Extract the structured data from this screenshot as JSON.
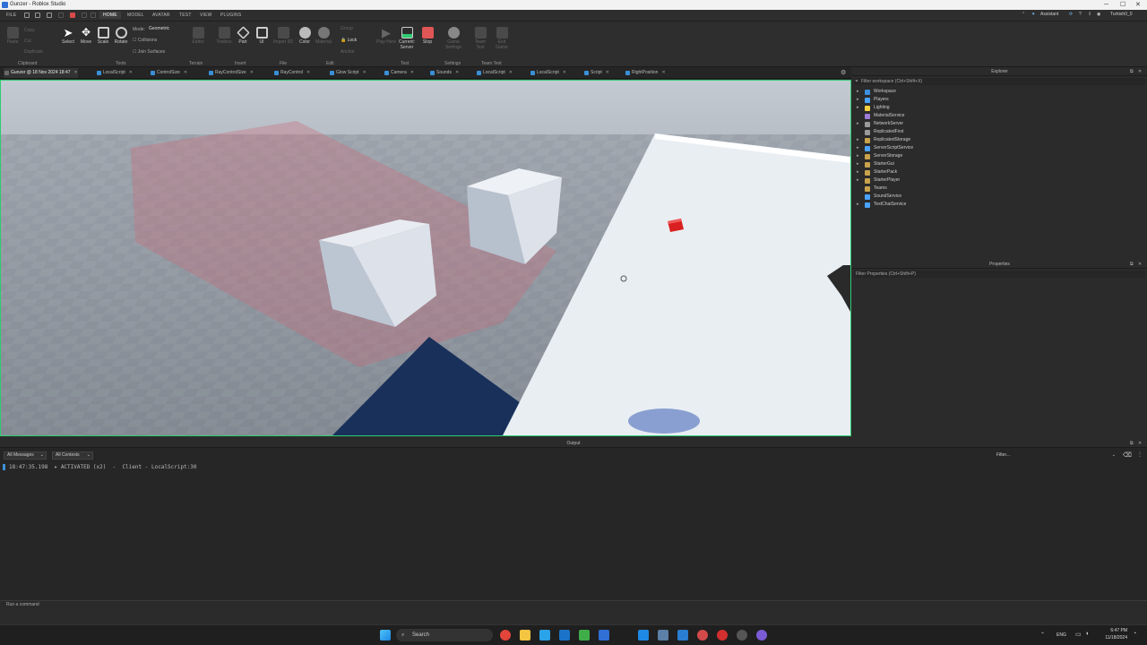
{
  "window": {
    "title": "Gunzer - Roblox Studio"
  },
  "menubar": {
    "tabs": [
      "FILE",
      "HOME",
      "MODEL",
      "AVATAR",
      "TEST",
      "VIEW",
      "PLUGINS"
    ],
    "active_tab": "HOME",
    "assistant_label": "Assistant",
    "user_label": "Turkish0_0"
  },
  "ribbon": {
    "clipboard": {
      "paste": "Paste",
      "copy": "Copy",
      "cut": "Cut",
      "duplicate": "Duplicate",
      "group": "Clipboard"
    },
    "tools": {
      "select": "Select",
      "move": "Move",
      "scale": "Scale",
      "rotate": "Rotate",
      "mode_label": "Mode:",
      "mode_value": "Geometric",
      "collisions": "Collisions",
      "join_surfaces": "Join Surfaces",
      "group": "Tools"
    },
    "terrain": {
      "editor": "Editor",
      "group": "Terrain"
    },
    "insert": {
      "toolbox": "Toolbox",
      "part": "Part",
      "ui": "UI",
      "group": "Insert"
    },
    "file": {
      "import3d": "Import 3D",
      "group": "File"
    },
    "edit": {
      "color": "Color",
      "material": "Material",
      "group_btn": "Group",
      "lock": "Lock",
      "anchor": "Anchor",
      "group": "Edit"
    },
    "test": {
      "play_here": "Play Here",
      "current_server": "Current: Server",
      "stop": "Stop",
      "group": "Test"
    },
    "settings": {
      "game_settings": "Game Settings",
      "group": "Settings"
    },
    "team_test": {
      "team_test": "Team Test",
      "exit_game": "Exit Game",
      "group": "Team Test"
    }
  },
  "doc_tabs": [
    {
      "label": "Gunzer @ 18 Nov 2024 18:47",
      "active": true
    },
    {
      "label": "LocalScript"
    },
    {
      "label": "ControlSize"
    },
    {
      "label": "RayControlSize"
    },
    {
      "label": "RayControl"
    },
    {
      "label": "Glow Script"
    },
    {
      "label": "Camera"
    },
    {
      "label": "Sounds"
    },
    {
      "label": "LocalScript"
    },
    {
      "label": "LocalScript"
    },
    {
      "label": "Script"
    },
    {
      "label": "RightPosition"
    }
  ],
  "explorer": {
    "title": "Explorer",
    "filter_placeholder": "Filter workspace (Ctrl+Shift+X)",
    "items": [
      {
        "label": "Workspace",
        "color": "#3d8fe0",
        "arrow": true
      },
      {
        "label": "Players",
        "color": "#4aa3ff",
        "arrow": true
      },
      {
        "label": "Lighting",
        "color": "#f5d142",
        "arrow": true
      },
      {
        "label": "MaterialService",
        "color": "#9e7bd6",
        "arrow": false
      },
      {
        "label": "NetworkServer",
        "color": "#9a9a9a",
        "arrow": true
      },
      {
        "label": "ReplicatedFirst",
        "color": "#9a9a9a",
        "arrow": false
      },
      {
        "label": "ReplicatedStorage",
        "color": "#c9a24b",
        "arrow": true
      },
      {
        "label": "ServerScriptService",
        "color": "#4aa3ff",
        "arrow": true
      },
      {
        "label": "ServerStorage",
        "color": "#c9a24b",
        "arrow": true
      },
      {
        "label": "StarterGui",
        "color": "#c9a24b",
        "arrow": true
      },
      {
        "label": "StarterPack",
        "color": "#c9a24b",
        "arrow": true
      },
      {
        "label": "StarterPlayer",
        "color": "#c9a24b",
        "arrow": true
      },
      {
        "label": "Teams",
        "color": "#c9a24b",
        "arrow": false
      },
      {
        "label": "SoundService",
        "color": "#4aa3ff",
        "arrow": false
      },
      {
        "label": "TextChatService",
        "color": "#4aa3ff",
        "arrow": true
      }
    ]
  },
  "properties": {
    "title": "Properties",
    "filter_placeholder": "Filter Properties (Ctrl+Shift+P)"
  },
  "output": {
    "title": "Output",
    "messages_filter": "All Messages",
    "contexts_filter": "All Contexts",
    "filter_placeholder": "Filter...",
    "log": {
      "time": "18:47:35.198",
      "text": "ACTIVATED (x2)",
      "source": "Client - LocalScript:30"
    }
  },
  "command_bar": {
    "placeholder": "Run a command"
  },
  "taskbar": {
    "search": "Search",
    "lang": "ENG",
    "time": "6:47 PM",
    "date": "11/18/2024"
  }
}
